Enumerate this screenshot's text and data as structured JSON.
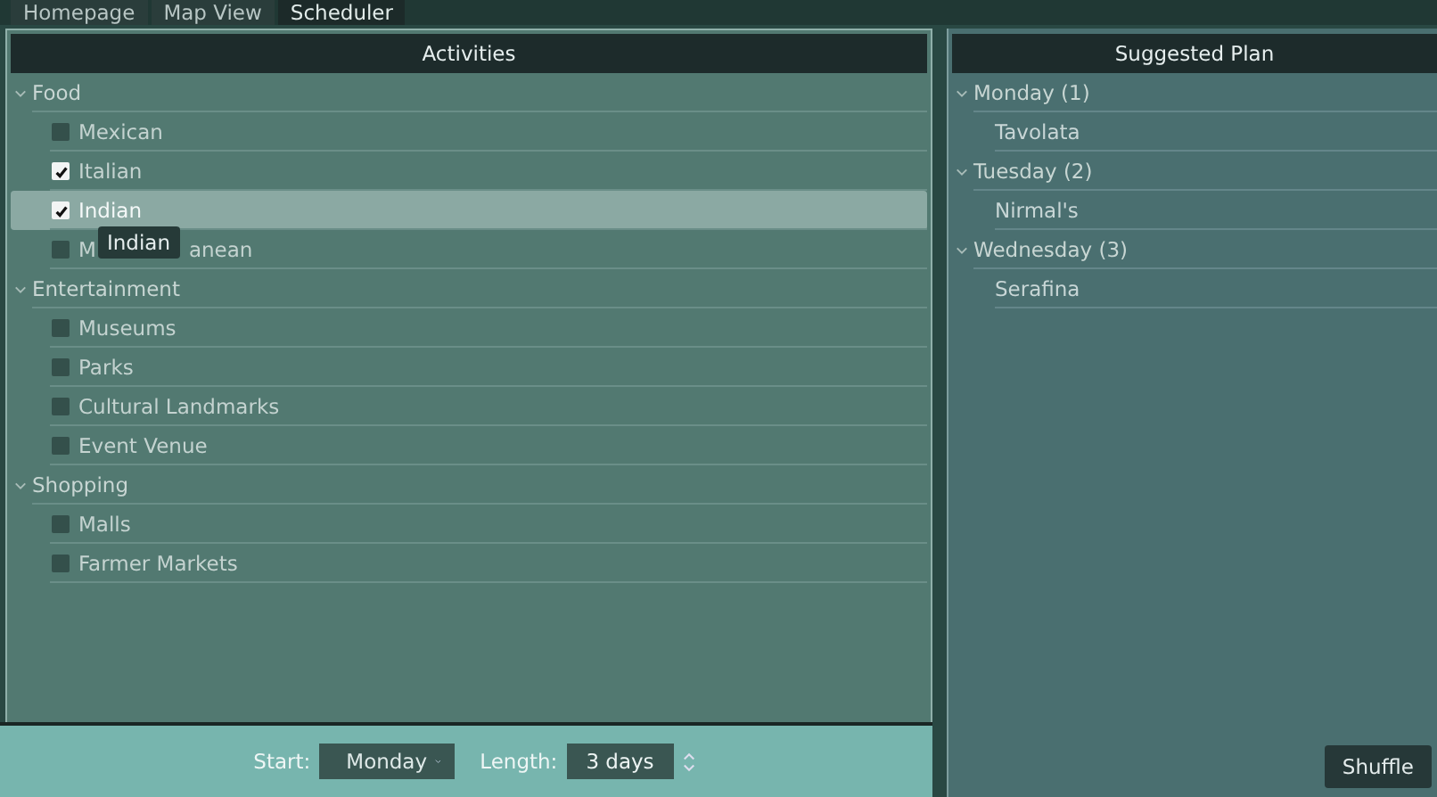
{
  "tabs": [
    {
      "label": "Homepage",
      "selected": false
    },
    {
      "label": "Map View",
      "selected": false
    },
    {
      "label": "Scheduler",
      "selected": true
    }
  ],
  "activities": {
    "title": "Activities",
    "categories": [
      {
        "name": "Food",
        "expanded": true,
        "items": [
          {
            "label": "Mexican",
            "checked": false,
            "selected": false
          },
          {
            "label": "Italian",
            "checked": true,
            "selected": false
          },
          {
            "label": "Indian",
            "checked": true,
            "selected": true
          },
          {
            "label_parts": [
              "M",
              "anean"
            ],
            "checked": false,
            "selected": false
          }
        ]
      },
      {
        "name": "Entertainment",
        "expanded": true,
        "items": [
          {
            "label": "Museums",
            "checked": false,
            "selected": false
          },
          {
            "label": "Parks",
            "checked": false,
            "selected": false
          },
          {
            "label": "Cultural Landmarks",
            "checked": false,
            "selected": false
          },
          {
            "label": "Event Venue",
            "checked": false,
            "selected": false
          }
        ]
      },
      {
        "name": "Shopping",
        "expanded": true,
        "items": [
          {
            "label": "Malls",
            "checked": false,
            "selected": false
          },
          {
            "label": "Farmer Markets",
            "checked": false,
            "selected": false
          }
        ]
      }
    ],
    "tooltip": "Indian"
  },
  "footer": {
    "start_label": "Start:",
    "start_value": "Monday",
    "length_label": "Length:",
    "length_value": "3  days"
  },
  "plan": {
    "title": "Suggested Plan",
    "days": [
      {
        "name": "Monday (1)",
        "expanded": true,
        "items": [
          "Tavolata"
        ]
      },
      {
        "name": "Tuesday (2)",
        "expanded": true,
        "items": [
          "Nirmal's"
        ]
      },
      {
        "name": "Wednesday (3)",
        "expanded": true,
        "items": [
          "Serafina"
        ]
      }
    ],
    "button": "Shuffle"
  }
}
